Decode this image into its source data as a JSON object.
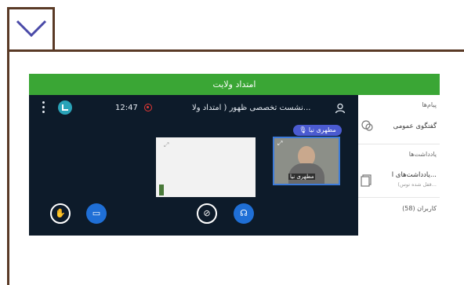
{
  "toggle": {
    "icon": "chevron-down-icon"
  },
  "meeting": {
    "header_title": "امتداد ولایت",
    "session_title": "نشست تخصصی ظهور ( امتداد ولا...",
    "timer": "12:47",
    "active_speaker": "مطهری نیا",
    "video_name_label": "مطهری نیا"
  },
  "side_panel": {
    "messages_heading": "پیام‌ها",
    "public_chat_label": "گفتگوی عمومی",
    "notes_heading": "یادداشت‌ها",
    "shared_notes_label": "یادداشت‌های ا...",
    "shared_notes_sub": "(قفل شده توس...",
    "users_label": "کاربران (58)"
  },
  "colors": {
    "frame_brown": "#5a3a26",
    "header_green": "#3aa635",
    "meeting_bg": "#0d1b2a",
    "accent_blue": "#1f6fd6",
    "speaker_badge": "#4b5bd1"
  },
  "icons": {
    "user_list": "user-icon",
    "record": "record-icon",
    "app": "app-logo-icon",
    "menu": "kebab-menu-icon",
    "audio": "headphones-icon",
    "camera": "camera-off-icon",
    "screen": "screen-share-icon",
    "hand": "raise-hand-icon"
  }
}
